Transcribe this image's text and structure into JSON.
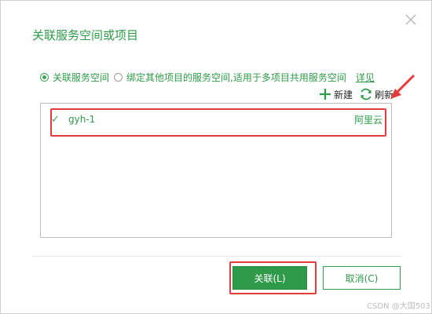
{
  "dialog": {
    "title": "关联服务空间或项目",
    "close_icon": "close-icon"
  },
  "options": {
    "selected_label": "关联服务空间",
    "other_label": "绑定其他项目的服务空间,适用于多项目共用服务空间",
    "details_link": "详见"
  },
  "toolbar": {
    "new_label": "新建",
    "refresh_label": "刷新"
  },
  "list": {
    "rows": [
      {
        "checked": true,
        "name": "gyh-1",
        "provider": "阿里云"
      }
    ]
  },
  "buttons": {
    "associate_label": "关联(L)",
    "cancel_label": "取消(C)"
  },
  "watermark": "CSDN @大国503",
  "colors": {
    "accent": "#2f9a49",
    "annotation": "#e33b3b"
  }
}
